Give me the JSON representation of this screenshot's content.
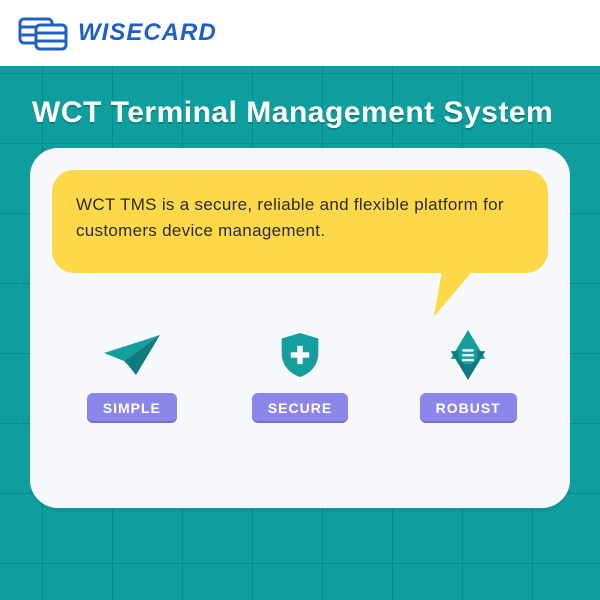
{
  "brand": {
    "name": "WISECARD"
  },
  "hero": {
    "title": "WCT Terminal Management System",
    "bubble_text": "WCT TMS is a secure, reliable and flexible platform for customers device management."
  },
  "features": [
    {
      "label": "SIMPLE",
      "icon": "paper-plane-icon"
    },
    {
      "label": "SECURE",
      "icon": "shield-plus-icon"
    },
    {
      "label": "ROBUST",
      "icon": "triangle-stack-icon"
    }
  ],
  "colors": {
    "brand_blue": "#1f60c2",
    "hero_teal": "#0f9e9e",
    "bubble_yellow": "#fdd94a",
    "pill_purple": "#8d86ea",
    "icon_teal": "#149e9e"
  }
}
